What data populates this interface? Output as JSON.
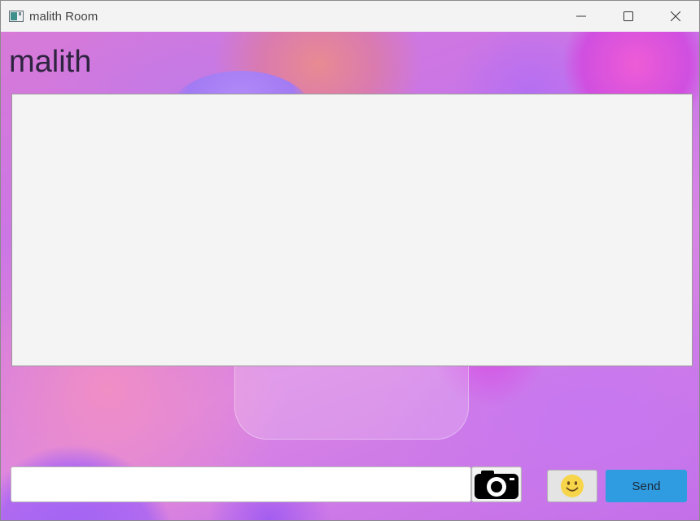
{
  "window": {
    "title": "malith Room",
    "icon": "app-window-icon",
    "controls": [
      "minimize-icon",
      "maximize-icon",
      "close-icon"
    ]
  },
  "room": {
    "name": "malith"
  },
  "chat": {
    "messages": []
  },
  "composer": {
    "message_value": "",
    "camera_icon": "camera-icon",
    "emoji_icon": "smiley-face-icon",
    "send_label": "Send"
  },
  "colors": {
    "send_button": "#2f9be0",
    "chat_area": "#f4f4f4",
    "emoji": "#f7d54a"
  }
}
